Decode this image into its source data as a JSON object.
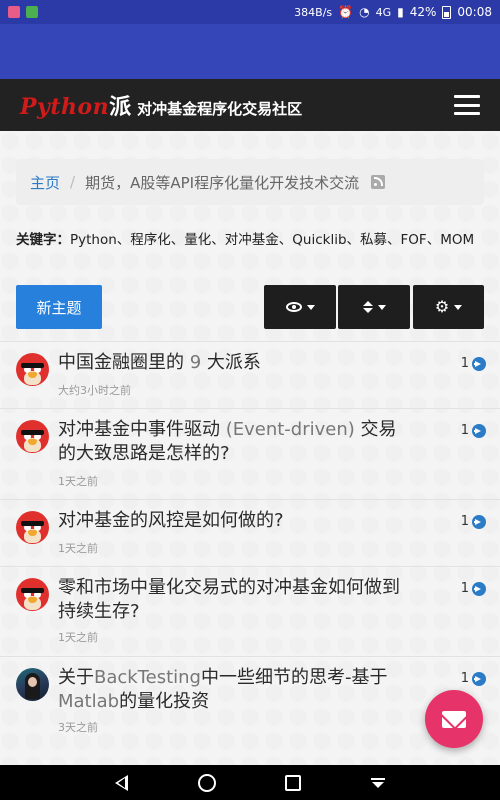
{
  "status_bar": {
    "net_speed": "384B/s",
    "network": "4G",
    "battery": "42%",
    "time": "00:08"
  },
  "header": {
    "logo_python": "Python",
    "logo_pai": "派",
    "logo_subtitle": "对冲基金程序化交易社区"
  },
  "breadcrumb": {
    "home": "主页",
    "separator": "/",
    "current": "期货，A股等API程序化量化开发技术交流"
  },
  "keywords": {
    "label": "关键字：",
    "text": "Python、程序化、量化、对冲基金、Quicklib、私募、FOF、MOM"
  },
  "toolbar": {
    "new_topic_label": "新主题"
  },
  "topics": [
    {
      "title_a": "中国金融圈里的",
      "title_light": " 9 ",
      "title_b": "大派系",
      "time": "大约3小时之前",
      "replies": "1",
      "avatar": "angry-bird"
    },
    {
      "title_a": "对冲基金中事件驱动",
      "title_light": " (Event-driven) ",
      "title_b": "交易的大致思路是怎样的?",
      "time": "1天之前",
      "replies": "1",
      "avatar": "angry-bird"
    },
    {
      "title_a": "对冲基金的风控是如何做的?",
      "title_light": "",
      "title_b": "",
      "time": "1天之前",
      "replies": "1",
      "avatar": "angry-bird"
    },
    {
      "title_a": "零和市场中量化交易式的对冲基金如何做到持续生存?",
      "title_light": "",
      "title_b": "",
      "time": "1天之前",
      "replies": "1",
      "avatar": "angry-bird"
    },
    {
      "title_a": "关于",
      "title_light": "BackTesting",
      "title_b": "中一些细节的思考-基于",
      "title_light2": "Matlab",
      "title_c": "的量化投资",
      "time": "3天之前",
      "replies": "1",
      "avatar": "photo"
    }
  ],
  "colors": {
    "status_bar": "#2b3aa6",
    "navbar": "#222222",
    "primary_button": "#2680dc",
    "fab": "#e6336a",
    "link": "#2b7bc7"
  },
  "icons": [
    "menu-icon",
    "rss-icon",
    "eye-icon",
    "sort-icon",
    "gear-icon",
    "arrow-circle-right-icon",
    "mail-icon"
  ]
}
